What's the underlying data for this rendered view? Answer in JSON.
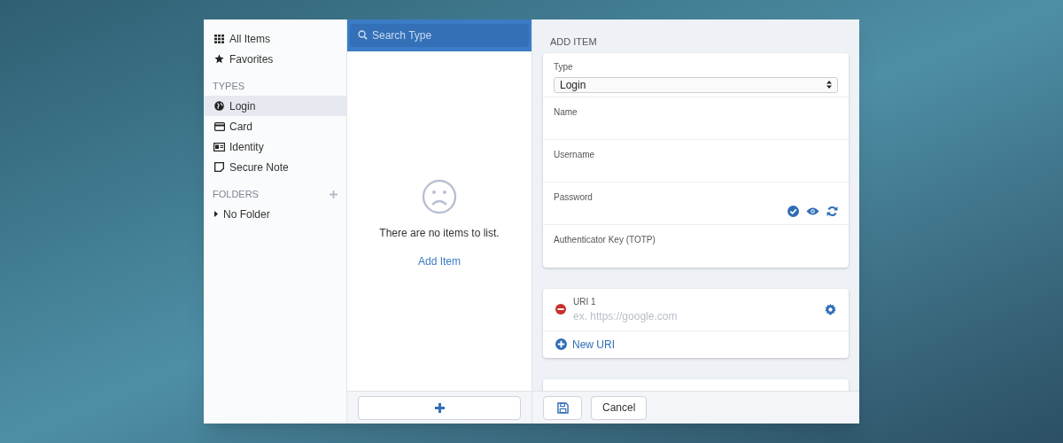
{
  "sidebar": {
    "top_items": [
      {
        "kind": "grid",
        "label": "All Items",
        "selected": false
      },
      {
        "kind": "star",
        "label": "Favorites",
        "selected": false
      }
    ],
    "types": {
      "heading": "TYPES",
      "items": [
        {
          "kind": "globe",
          "label": "Login",
          "selected": true
        },
        {
          "kind": "card",
          "label": "Card",
          "selected": false
        },
        {
          "kind": "id",
          "label": "Identity",
          "selected": false
        },
        {
          "kind": "note",
          "label": "Secure Note",
          "selected": false
        }
      ]
    },
    "folders": {
      "heading": "FOLDERS",
      "items": [
        {
          "label": "No Folder",
          "expanded": false
        }
      ]
    }
  },
  "list": {
    "search": {
      "placeholder": "Search Type"
    },
    "empty_message": "There are no items to list.",
    "add_link": "Add Item"
  },
  "editor": {
    "heading": "ADD ITEM",
    "fields": [
      {
        "kind": "select",
        "label": "Type",
        "value": "Login"
      },
      {
        "kind": "text",
        "label": "Name"
      },
      {
        "kind": "text",
        "label": "Username"
      },
      {
        "kind": "password",
        "label": "Password"
      },
      {
        "kind": "text",
        "label": "Authenticator Key (TOTP)"
      }
    ],
    "uris": [
      {
        "label": "URI 1",
        "placeholder": "ex. https://google.com"
      }
    ],
    "new_uri": "New URI",
    "cancel": "Cancel"
  }
}
